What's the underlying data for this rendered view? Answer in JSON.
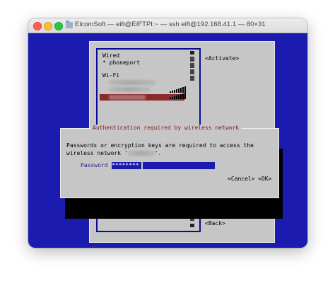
{
  "window": {
    "title": "ElcomSoft — eift@EIFTPI:~ — ssh eift@192.168.41.1 — 80×31",
    "icons": [
      "close-icon",
      "minimize-icon",
      "zoom-icon",
      "folder-icon"
    ]
  },
  "colors": {
    "terminal_bg": "#1b1baf",
    "panel_bg": "#c6c6c6",
    "selection": "#8a2a2a",
    "dialog_title": "#8a1a1a"
  },
  "connections": {
    "wired_header": "Wired",
    "wired_items": [
      "* phoneport"
    ],
    "wifi_header": "Wi-Fi",
    "activate_label": "<Activate>",
    "back_label": "<Back>"
  },
  "dialog": {
    "title": "Authentication required by wireless network",
    "message_line1": "Passwords or encryption keys are required to access the",
    "message_line2": "wireless network '",
    "message_line2_end": "'.",
    "password_label": "Password",
    "password_mask": "********",
    "cancel_label": "<Cancel>",
    "ok_label": "<OK>"
  }
}
